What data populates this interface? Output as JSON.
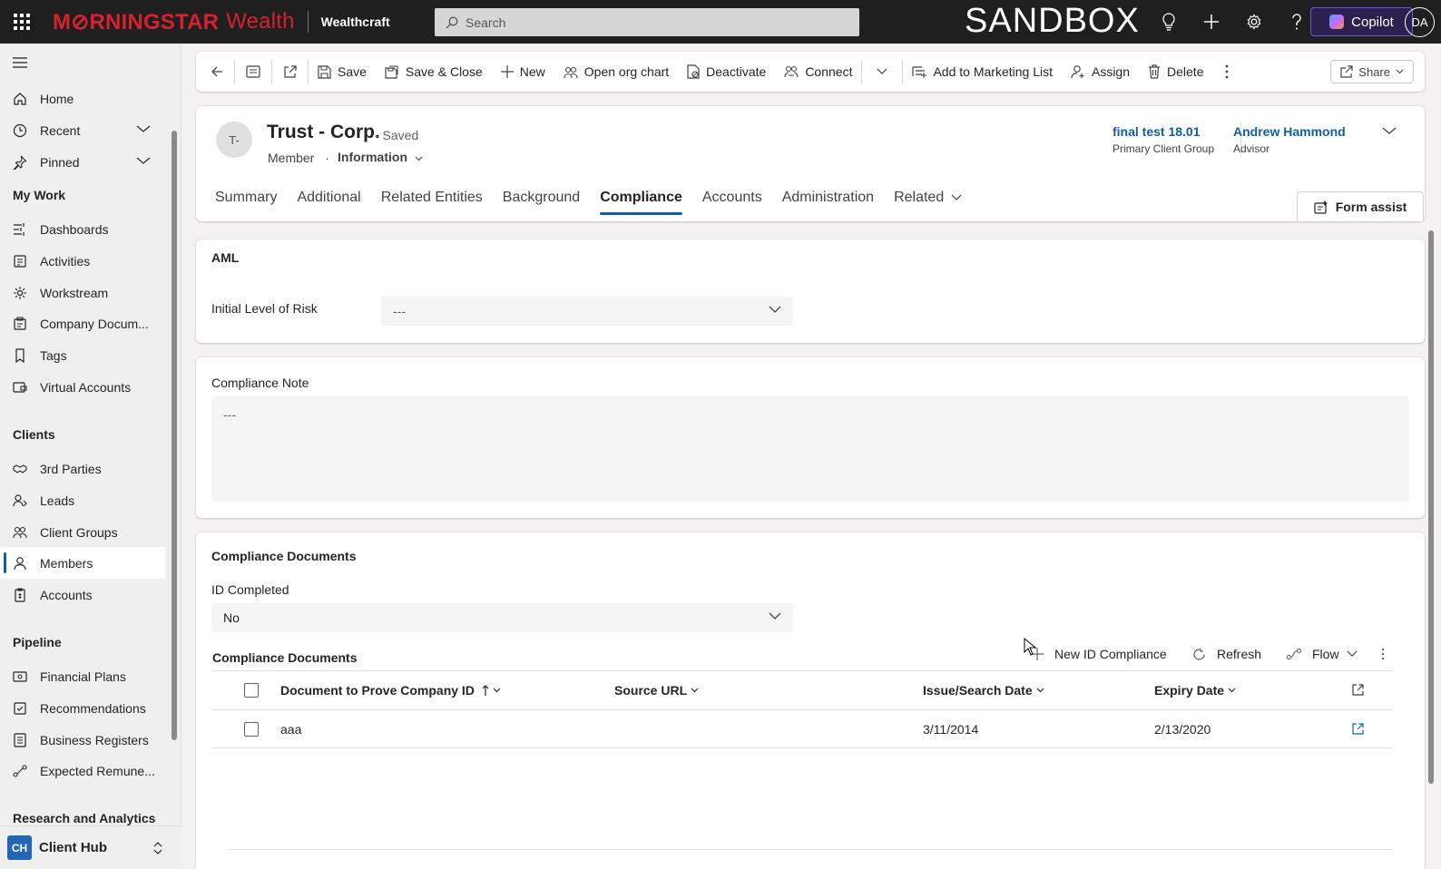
{
  "topbar": {
    "brand_part1": "M⊘RNINGSTAR",
    "brand_part2": "Wealth",
    "app_name": "Wealthcraft",
    "search_placeholder": "Search",
    "environment": "SANDBOX",
    "copilot_label": "Copilot",
    "user_initials": "DA",
    "icons": [
      "lightbulb-icon",
      "plus-icon",
      "gear-icon",
      "help-icon"
    ]
  },
  "sidebar": {
    "top_items": [
      {
        "label": "Home",
        "icon": "home-icon"
      },
      {
        "label": "Recent",
        "icon": "clock-icon"
      },
      {
        "label": "Pinned",
        "icon": "pin-icon"
      }
    ],
    "groups": [
      {
        "title": "My Work",
        "items": [
          {
            "label": "Dashboards",
            "icon": "dashboard-icon"
          },
          {
            "label": "Activities",
            "icon": "activities-icon"
          },
          {
            "label": "Workstream",
            "icon": "workstream-icon"
          },
          {
            "label": "Company Docum...",
            "icon": "document-icon"
          },
          {
            "label": "Tags",
            "icon": "tag-icon"
          },
          {
            "label": "Virtual Accounts",
            "icon": "virtual-account-icon"
          }
        ]
      },
      {
        "title": "Clients",
        "items": [
          {
            "label": "3rd Parties",
            "icon": "handshake-icon"
          },
          {
            "label": "Leads",
            "icon": "leads-icon"
          },
          {
            "label": "Client Groups",
            "icon": "client-groups-icon"
          },
          {
            "label": "Members",
            "icon": "person-icon",
            "active": true
          },
          {
            "label": "Accounts",
            "icon": "accounts-icon"
          }
        ]
      },
      {
        "title": "Pipeline",
        "items": [
          {
            "label": "Financial Plans",
            "icon": "financial-plan-icon"
          },
          {
            "label": "Recommendations",
            "icon": "recommendation-icon"
          },
          {
            "label": "Business Registers",
            "icon": "register-icon"
          },
          {
            "label": "Expected Remune...",
            "icon": "remuneration-icon"
          }
        ]
      },
      {
        "title": "Research and Analytics",
        "items": []
      }
    ],
    "area": {
      "badge": "CH",
      "label": "Client Hub"
    }
  },
  "commands": {
    "save": "Save",
    "save_close": "Save & Close",
    "new": "New",
    "org_chart": "Open org chart",
    "deactivate": "Deactivate",
    "connect": "Connect",
    "marketing_list": "Add to Marketing List",
    "assign": "Assign",
    "delete": "Delete",
    "share": "Share"
  },
  "record": {
    "avatar": "T-",
    "title": "Trust - Corp.",
    "saved_status": "- Saved",
    "entity": "Member",
    "separator": "·",
    "form_name": "Information",
    "header_fields": [
      {
        "value": "final test 18.01",
        "label": "Primary Client Group"
      },
      {
        "value": "Andrew Hammond",
        "label": "Advisor"
      }
    ],
    "tabs": [
      "Summary",
      "Additional",
      "Related Entities",
      "Background",
      "Compliance",
      "Accounts",
      "Administration",
      "Related"
    ],
    "active_tab": "Compliance",
    "form_assist": "Form assist"
  },
  "aml": {
    "title": "AML",
    "risk_label": "Initial Level of Risk",
    "risk_value": "---"
  },
  "note": {
    "label": "Compliance Note",
    "value": "---"
  },
  "docs": {
    "title": "Compliance Documents",
    "id_label": "ID Completed",
    "id_value": "No",
    "subgrid_title": "Compliance Documents",
    "new_btn": "New ID Compliance",
    "refresh_btn": "Refresh",
    "flow_btn": "Flow",
    "columns": [
      "Document to Prove Company ID",
      "Source URL",
      "Issue/Search Date",
      "Expiry Date"
    ],
    "rows": [
      {
        "document": "aaa",
        "source_url": "",
        "issue_date": "3/11/2014",
        "expiry_date": "2/13/2020"
      }
    ]
  }
}
